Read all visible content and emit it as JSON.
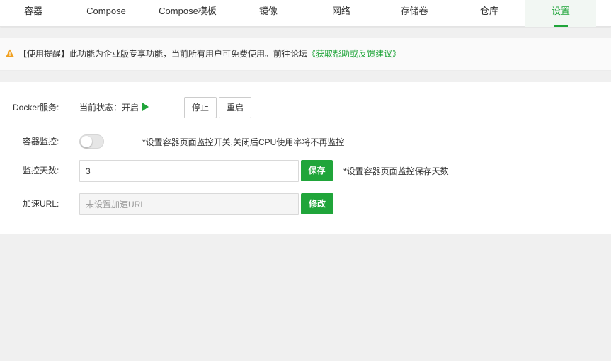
{
  "tabs": [
    {
      "label": "容器"
    },
    {
      "label": "Compose"
    },
    {
      "label": "Compose模板"
    },
    {
      "label": "镜像"
    },
    {
      "label": "网络"
    },
    {
      "label": "存储卷"
    },
    {
      "label": "仓库"
    },
    {
      "label": "设置",
      "active": true
    }
  ],
  "notice": {
    "text": "【使用提醒】此功能为企业版专享功能，当前所有用户可免费使用。前往论坛",
    "link": "《获取帮助或反馈建议》",
    "icon": "warning-icon",
    "icon_color": "#f0a020"
  },
  "docker_service": {
    "label": "Docker服务:",
    "status_prefix": "当前状态：",
    "status": "开启",
    "status_icon": "play-icon",
    "stop_label": "停止",
    "restart_label": "重启"
  },
  "monitor": {
    "label": "容器监控:",
    "enabled": false,
    "hint": "*设置容器页面监控开关,关闭后CPU使用率将不再监控"
  },
  "monitor_days": {
    "label": "监控天数:",
    "value": "3",
    "save_label": "保存",
    "hint": "*设置容器页面监控保存天数"
  },
  "accel_url": {
    "label": "加速URL:",
    "value": "",
    "placeholder": "未设置加速URL",
    "modify_label": "修改"
  },
  "colors": {
    "accent": "#20a53a",
    "background": "#f0f0f0"
  }
}
